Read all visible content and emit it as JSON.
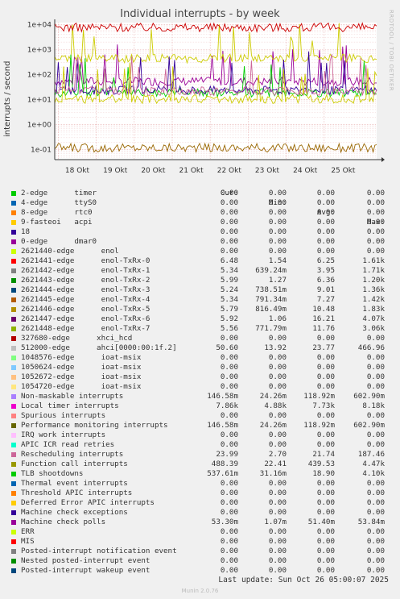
{
  "chart_data": {
    "type": "line",
    "title": "Individual interrupts - by week",
    "ylabel": "interrupts / second",
    "yscale": "log",
    "ylim": [
      0.04,
      12000
    ],
    "y_ticks": [
      "1e-01",
      "1e+00",
      "1e+01",
      "1e+02",
      "1e+03",
      "1e+04"
    ],
    "y_tick_values": [
      0.1,
      1,
      10,
      100,
      1000,
      10000
    ],
    "x_ticks": [
      "18 Okt",
      "19 Okt",
      "20 Okt",
      "21 Okt",
      "22 Okt",
      "23 Okt",
      "24 Okt",
      "25 Okt"
    ],
    "grid": true,
    "series_levels": [
      {
        "name": "Machine check polls",
        "color": "#990099",
        "level": 53.3
      },
      {
        "name": "Function call interrupts",
        "color": "#cccc00",
        "level": 439.53
      },
      {
        "name": "Local timer interrupts",
        "color": "#cc0000",
        "level": 7730
      },
      {
        "name": "TLB shootdowns",
        "color": "#00cc00",
        "level": 18.9
      },
      {
        "name": "Performance monitoring interrupts",
        "color": "#996600",
        "level": 0.119
      },
      {
        "name": "512000-edge ahci",
        "color": "#330099",
        "level": 23.77
      },
      {
        "name": "Rescheduling interrupts",
        "color": "#cc6699",
        "level": 21.74
      },
      {
        "name": "2621446-edge enol-TxRx-5",
        "color": "#cccc00",
        "level": 10.48
      }
    ]
  },
  "legend": {
    "headers": [
      "Cur:",
      "Min:",
      "Avg:",
      "Max:"
    ],
    "rows": [
      {
        "label": "2-edge      timer",
        "color": "#00cc00",
        "cur": "0.00",
        "min": "0.00",
        "avg": "0.00",
        "max": "0.00"
      },
      {
        "label": "4-edge      ttyS0",
        "color": "#0066b3",
        "cur": "0.00",
        "min": "0.00",
        "avg": "0.00",
        "max": "0.00"
      },
      {
        "label": "8-edge      rtc0",
        "color": "#ff8000",
        "cur": "0.00",
        "min": "0.00",
        "avg": "0.00",
        "max": "0.00"
      },
      {
        "label": "9-fasteoi   acpi",
        "color": "#ffcc00",
        "cur": "0.00",
        "min": "0.00",
        "avg": "0.00",
        "max": "0.00"
      },
      {
        "label": "18",
        "color": "#330099",
        "cur": "0.00",
        "min": "0.00",
        "avg": "0.00",
        "max": "0.00"
      },
      {
        "label": "0-edge      dmar0",
        "color": "#990099",
        "cur": "0.00",
        "min": "0.00",
        "avg": "0.00",
        "max": "0.00"
      },
      {
        "label": "2621440-edge      enol",
        "color": "#ccff00",
        "cur": "0.00",
        "min": "0.00",
        "avg": "0.00",
        "max": "0.00"
      },
      {
        "label": "2621441-edge      enol-TxRx-0",
        "color": "#ff0000",
        "cur": "6.48",
        "min": "1.54",
        "avg": "6.25",
        "max": "1.61k"
      },
      {
        "label": "2621442-edge      enol-TxRx-1",
        "color": "#808080",
        "cur": "5.34",
        "min": "639.24m",
        "avg": "3.95",
        "max": "1.71k"
      },
      {
        "label": "2621443-edge      enol-TxRx-2",
        "color": "#008f00",
        "cur": "5.99",
        "min": "1.27",
        "avg": "6.36",
        "max": "1.20k"
      },
      {
        "label": "2621444-edge      enol-TxRx-3",
        "color": "#00487d",
        "cur": "5.24",
        "min": "738.51m",
        "avg": "9.01",
        "max": "1.36k"
      },
      {
        "label": "2621445-edge      enol-TxRx-4",
        "color": "#b35a00",
        "cur": "5.34",
        "min": "791.34m",
        "avg": "7.27",
        "max": "1.42k"
      },
      {
        "label": "2621446-edge      enol-TxRx-5",
        "color": "#b38f00",
        "cur": "5.79",
        "min": "816.49m",
        "avg": "10.48",
        "max": "1.83k"
      },
      {
        "label": "2621447-edge      enol-TxRx-6",
        "color": "#6b006b",
        "cur": "5.92",
        "min": "1.06",
        "avg": "16.21",
        "max": "4.07k"
      },
      {
        "label": "2621448-edge      enol-TxRx-7",
        "color": "#8fb300",
        "cur": "5.56",
        "min": "771.79m",
        "avg": "11.76",
        "max": "3.06k"
      },
      {
        "label": "327680-edge      xhci_hcd",
        "color": "#b30000",
        "cur": "0.00",
        "min": "0.00",
        "avg": "0.00",
        "max": "0.00"
      },
      {
        "label": "512000-edge      ahci[0000:00:1f.2]",
        "color": "#bebebe",
        "cur": "50.60",
        "min": "13.92",
        "avg": "23.77",
        "max": "466.96"
      },
      {
        "label": "1048576-edge      ioat-msix",
        "color": "#80ff80",
        "cur": "0.00",
        "min": "0.00",
        "avg": "0.00",
        "max": "0.00"
      },
      {
        "label": "1050624-edge      ioat-msix",
        "color": "#80c9ff",
        "cur": "0.00",
        "min": "0.00",
        "avg": "0.00",
        "max": "0.00"
      },
      {
        "label": "1052672-edge      ioat-msix",
        "color": "#ffc080",
        "cur": "0.00",
        "min": "0.00",
        "avg": "0.00",
        "max": "0.00"
      },
      {
        "label": "1054720-edge      ioat-msix",
        "color": "#ffe680",
        "cur": "0.00",
        "min": "0.00",
        "avg": "0.00",
        "max": "0.00"
      },
      {
        "label": "Non-maskable interrupts",
        "color": "#aa80ff",
        "cur": "146.58m",
        "min": "24.26m",
        "avg": "118.92m",
        "max": "602.90m"
      },
      {
        "label": "Local timer interrupts",
        "color": "#ee00cc",
        "cur": "7.86k",
        "min": "4.88k",
        "avg": "7.73k",
        "max": "8.18k"
      },
      {
        "label": "Spurious interrupts",
        "color": "#ff8080",
        "cur": "0.00",
        "min": "0.00",
        "avg": "0.00",
        "max": "0.00"
      },
      {
        "label": "Performance monitoring interrupts",
        "color": "#666600",
        "cur": "146.58m",
        "min": "24.26m",
        "avg": "118.92m",
        "max": "602.90m"
      },
      {
        "label": "IRQ work interrupts",
        "color": "#ffbfff",
        "cur": "0.00",
        "min": "0.00",
        "avg": "0.00",
        "max": "0.00"
      },
      {
        "label": "APIC ICR read retries",
        "color": "#00ffcc",
        "cur": "0.00",
        "min": "0.00",
        "avg": "0.00",
        "max": "0.00"
      },
      {
        "label": "Rescheduling interrupts",
        "color": "#cc6699",
        "cur": "23.99",
        "min": "2.70",
        "avg": "21.74",
        "max": "187.46"
      },
      {
        "label": "Function call interrupts",
        "color": "#999900",
        "cur": "488.39",
        "min": "22.41",
        "avg": "439.53",
        "max": "4.47k"
      },
      {
        "label": "TLB shootdowns",
        "color": "#00cc00",
        "cur": "537.61m",
        "min": "31.16m",
        "avg": "18.90",
        "max": "4.10k"
      },
      {
        "label": "Thermal event interrupts",
        "color": "#0066b3",
        "cur": "0.00",
        "min": "0.00",
        "avg": "0.00",
        "max": "0.00"
      },
      {
        "label": "Threshold APIC interrupts",
        "color": "#ff8000",
        "cur": "0.00",
        "min": "0.00",
        "avg": "0.00",
        "max": "0.00"
      },
      {
        "label": "Deferred Error APIC interrupts",
        "color": "#ffcc00",
        "cur": "0.00",
        "min": "0.00",
        "avg": "0.00",
        "max": "0.00"
      },
      {
        "label": "Machine check exceptions",
        "color": "#330099",
        "cur": "0.00",
        "min": "0.00",
        "avg": "0.00",
        "max": "0.00"
      },
      {
        "label": "Machine check polls",
        "color": "#990099",
        "cur": "53.30m",
        "min": "1.07m",
        "avg": "51.40m",
        "max": "53.84m"
      },
      {
        "label": "ERR",
        "color": "#ccff00",
        "cur": "0.00",
        "min": "0.00",
        "avg": "0.00",
        "max": "0.00"
      },
      {
        "label": "MIS",
        "color": "#ff0000",
        "cur": "0.00",
        "min": "0.00",
        "avg": "0.00",
        "max": "0.00"
      },
      {
        "label": "Posted-interrupt notification event",
        "color": "#808080",
        "cur": "0.00",
        "min": "0.00",
        "avg": "0.00",
        "max": "0.00"
      },
      {
        "label": "Nested posted-interrupt event",
        "color": "#008f00",
        "cur": "0.00",
        "min": "0.00",
        "avg": "0.00",
        "max": "0.00"
      },
      {
        "label": "Posted-interrupt wakeup event",
        "color": "#00487d",
        "cur": "0.00",
        "min": "0.00",
        "avg": "0.00",
        "max": "0.00"
      }
    ]
  },
  "footer": {
    "last_update": "Last update: Sun Oct 26 05:00:07 2025",
    "watermark": "RRDTOOL / TOBI OETIKER",
    "munin": "Munin 2.0.76"
  }
}
